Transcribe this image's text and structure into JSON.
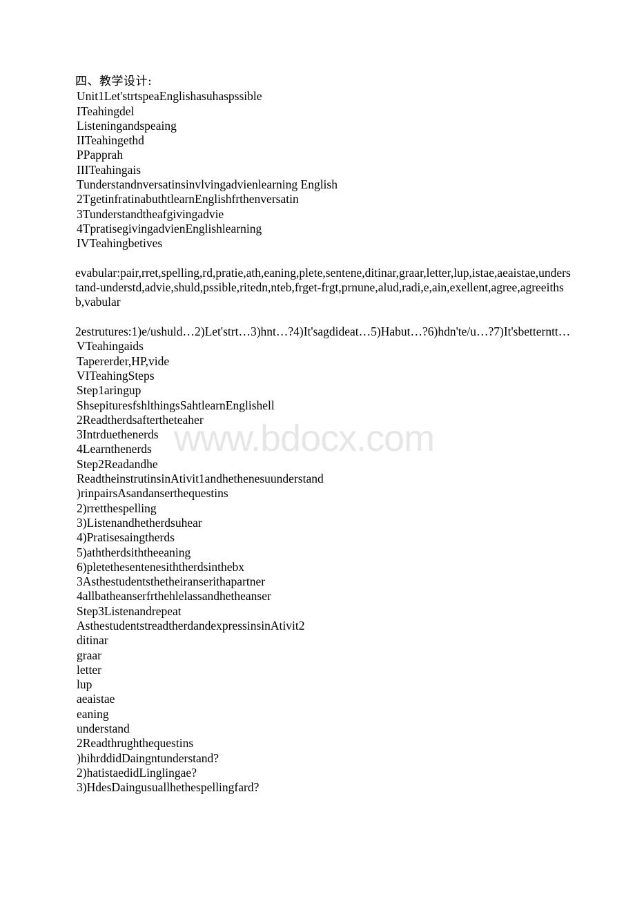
{
  "document": {
    "watermark": "www.bdocx.com",
    "heading": "四、教学设计:",
    "lines_top": [
      "Unit1Let'strtspeaEnglishasuhaspssible",
      "ITeahingdel",
      "Listeningandspeaing",
      "IITeahingethd",
      "PPapprah",
      "IIITeahingais",
      "Tunderstandnversatinsinvlvingadvienlearning English",
      "2TgetinfratinabuthtlearnEnglishfrthenversatin",
      "3Tunderstandtheafgivingadvie",
      "4TpratisegivingadvienEnglishlearning",
      "IVTeahingbetives"
    ],
    "vocabulary_paragraph": "evabular:pair,rret,spelling,rd,pratie,ath,eaning,plete,sentene,ditinar,graar,letter,lup,istae,aeaistae,understand-understd,advie,shuld,pssible,ritedn,nteb,frget-frgt,prnune,alud,radi,e,ain,exellent,agree,agreeithsb,vabular",
    "structures_paragraph": "2estrutures:1)e/ushuld…2)Let'strt…3)hnt…?4)It'sagdideat…5)Habut…?6)hdn'te/u…?7)It'sbetterntt…",
    "lines_middle": [
      "VTeahingaids",
      "Tapererder,HP,vide",
      "VITeahingSteps",
      "Step1aringup",
      "ShsepituresfshlthingsSahtlearnEnglishell",
      "2Readtherdsaftertheteaher",
      "3Intrduethenerds",
      "4Learnthenerds",
      "Step2Readandhe",
      "ReadtheinstrutinsinAtivit1andhethenesuunderstand",
      ")rinpairsAsandanserthequestins",
      "2)rretthespelling",
      "3)Listenandhetherdsuhear",
      "4)Pratisesaingtherds",
      "5)aththerdsiththeeaning",
      "6)pletethesentenesiththerdsinthebx",
      "3Asthestudentsthetheiranserithapartner",
      "4allbatheanserfrthehlelassandhetheanser",
      "Step3Listenandrepeat",
      "AsthestudentstreadtherdandexpressinsinAtivit2",
      "ditinar",
      "graar",
      "letter",
      "lup",
      "aeaistae",
      "eaning",
      "understand",
      "2Readthrughthequestins",
      ")hihrddidDaingntunderstand?",
      "2)hatistaedidLinglingae?",
      "3)HdesDaingusuallhethespellingfard?"
    ]
  }
}
